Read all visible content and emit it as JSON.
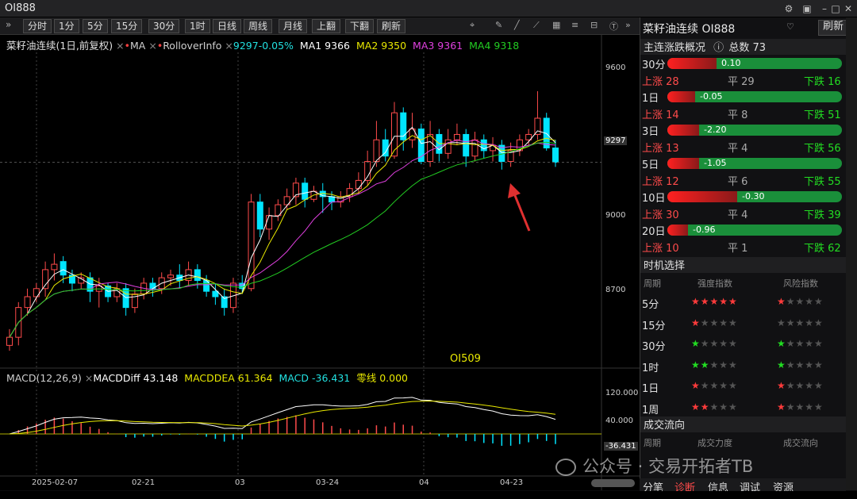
{
  "window": {
    "title": "OI888",
    "icons": [
      "gear-icon",
      "lock-icon",
      "minimize-icon",
      "maximize-icon",
      "close-icon"
    ]
  },
  "toolbar": {
    "expand": "»",
    "buttons": [
      "分时",
      "1分",
      "5分",
      "15分",
      "30分",
      "1时",
      "日线",
      "周线",
      "月线",
      "上翻",
      "下翻",
      "刷新"
    ]
  },
  "chart": {
    "legend": {
      "name": "菜籽油连续(1日,前复权)",
      "ma": "MA",
      "rollover": "RolloverInfo",
      "value": "9297-0.05%",
      "ma1": "MA1 9366",
      "ma2": "MA2 9350",
      "ma3": "MA3 9361",
      "ma4": "MA4 9318"
    },
    "prices": [
      "9600",
      "9297",
      "9000",
      "8700"
    ],
    "contract": "OI509",
    "macd": {
      "name": "MACD(12,26,9)",
      "diff": "MACDDiff 43.148",
      "dea": "MACDDEA 61.364",
      "macd": "MACD -36.431",
      "zero": "零线 0.000",
      "ticks": [
        "120.000",
        "40.000",
        "-36.431"
      ]
    },
    "dates": [
      "2025-02-07",
      "02-21",
      "03",
      "03-24",
      "04",
      "04-23"
    ],
    "colors": {
      "up": "#ff4b4b",
      "down": "#00e5ff",
      "ma1": "#ffffff",
      "ma2": "#e8e800",
      "ma3": "#e040e0",
      "ma4": "#22cc22"
    }
  },
  "chart_data": {
    "type": "candlestick",
    "title": "菜籽油连续(1日,前复权)",
    "ylim": [
      8580,
      9680
    ],
    "candles": [
      [
        8620,
        8650,
        8600,
        8680
      ],
      [
        8650,
        8760,
        8620,
        8780
      ],
      [
        8760,
        8800,
        8730,
        8830
      ],
      [
        8800,
        8830,
        8780,
        8850
      ],
      [
        8830,
        8900,
        8800,
        8930
      ],
      [
        8900,
        8920,
        8860,
        8960
      ],
      [
        8930,
        8880,
        8850,
        8950
      ],
      [
        8880,
        8850,
        8820,
        8900
      ],
      [
        8850,
        8870,
        8830,
        8890
      ],
      [
        8870,
        8820,
        8780,
        8890
      ],
      [
        8820,
        8840,
        8760,
        8870
      ],
      [
        8840,
        8800,
        8780,
        8850
      ],
      [
        8800,
        8830,
        8780,
        8850
      ],
      [
        8830,
        8760,
        8730,
        8850
      ],
      [
        8760,
        8810,
        8740,
        8830
      ],
      [
        8810,
        8850,
        8790,
        8870
      ],
      [
        8850,
        8830,
        8800,
        8870
      ],
      [
        8830,
        8870,
        8810,
        8890
      ],
      [
        8870,
        8880,
        8840,
        8900
      ],
      [
        8880,
        8860,
        8830,
        8920
      ],
      [
        8860,
        8900,
        8840,
        8930
      ],
      [
        8900,
        8860,
        8830,
        8920
      ],
      [
        8860,
        8820,
        8800,
        8880
      ],
      [
        8820,
        8800,
        8770,
        8850
      ],
      [
        8800,
        8760,
        8730,
        8830
      ],
      [
        8760,
        8850,
        8740,
        8870
      ],
      [
        8850,
        8830,
        8810,
        8880
      ],
      [
        8830,
        9150,
        8820,
        9180
      ],
      [
        9150,
        9050,
        9020,
        9180
      ],
      [
        9050,
        9100,
        9010,
        9130
      ],
      [
        9100,
        9140,
        9080,
        9160
      ],
      [
        9140,
        9170,
        9120,
        9200
      ],
      [
        9170,
        9220,
        9140,
        9240
      ],
      [
        9220,
        9160,
        9130,
        9240
      ],
      [
        9160,
        9190,
        9150,
        9210
      ],
      [
        9190,
        9170,
        9110,
        9220
      ],
      [
        9170,
        9150,
        9120,
        9190
      ],
      [
        9150,
        9170,
        9130,
        9190
      ],
      [
        9170,
        9200,
        9150,
        9220
      ],
      [
        9200,
        9230,
        9180,
        9260
      ],
      [
        9230,
        9300,
        9210,
        9340
      ],
      [
        9300,
        9380,
        9280,
        9450
      ],
      [
        9380,
        9320,
        9300,
        9420
      ],
      [
        9320,
        9480,
        9310,
        9520
      ],
      [
        9480,
        9380,
        9340,
        9500
      ],
      [
        9380,
        9420,
        9350,
        9480
      ],
      [
        9420,
        9300,
        9290,
        9440
      ],
      [
        9300,
        9400,
        9280,
        9450
      ],
      [
        9400,
        9330,
        9300,
        9420
      ],
      [
        9330,
        9380,
        9310,
        9420
      ],
      [
        9380,
        9400,
        9360,
        9440
      ],
      [
        9400,
        9320,
        9280,
        9420
      ],
      [
        9320,
        9380,
        9300,
        9410
      ],
      [
        9380,
        9340,
        9310,
        9400
      ],
      [
        9340,
        9360,
        9300,
        9390
      ],
      [
        9360,
        9300,
        9270,
        9380
      ],
      [
        9300,
        9340,
        9280,
        9370
      ],
      [
        9340,
        9380,
        9320,
        9400
      ],
      [
        9380,
        9400,
        9360,
        9420
      ],
      [
        9400,
        9460,
        9380,
        9560
      ],
      [
        9460,
        9350,
        9340,
        9480
      ],
      [
        9350,
        9297,
        9280,
        9380
      ]
    ],
    "series": [
      {
        "name": "MA1",
        "value": 9366
      },
      {
        "name": "MA2",
        "value": 9350
      },
      {
        "name": "MA3",
        "value": 9361
      },
      {
        "name": "MA4",
        "value": 9318
      }
    ],
    "macd": {
      "diff": 43.148,
      "dea": 61.364,
      "macd": -36.431,
      "zero": 0
    }
  },
  "panel": {
    "title": "菜籽油连续 OI888",
    "refresh": "刷新",
    "overview_title": "主连涨跌概况",
    "total": "总数 73",
    "rows": [
      {
        "period": "30分",
        "value": "0.10",
        "red": 0.28,
        "up": "上涨 28",
        "flat": "平 29",
        "down": "下跌 16"
      },
      {
        "period": "1日",
        "value": "-0.05",
        "red": 0.16,
        "up": "上涨 14",
        "flat": "平 8",
        "down": "下跌 51"
      },
      {
        "period": "3日",
        "value": "-2.20",
        "red": 0.18,
        "up": "上涨 13",
        "flat": "平 4",
        "down": "下跌 56"
      },
      {
        "period": "5日",
        "value": "-1.05",
        "red": 0.18,
        "up": "上涨 12",
        "flat": "平 6",
        "down": "下跌 55"
      },
      {
        "period": "10日",
        "value": "-0.30",
        "red": 0.4,
        "up": "上涨 30",
        "flat": "平 4",
        "down": "下跌 39"
      },
      {
        "period": "20日",
        "value": "-0.96",
        "red": 0.12,
        "up": "上涨 10",
        "flat": "平 1",
        "down": "下跌 62"
      }
    ],
    "timing_title": "时机选择",
    "timing_headers": [
      "周期",
      "强度指数",
      "风险指数"
    ],
    "timing": [
      {
        "period": "5分",
        "strength": 5,
        "s_color": "#ff3b3b",
        "risk": 1,
        "r_color": "#ff3b3b"
      },
      {
        "period": "15分",
        "strength": 1,
        "s_color": "#ff3b3b",
        "risk": 0,
        "r_color": "#ff3b3b"
      },
      {
        "period": "30分",
        "strength": 1,
        "s_color": "#22dd22",
        "risk": 1,
        "r_color": "#22dd22"
      },
      {
        "period": "1时",
        "strength": 2,
        "s_color": "#22dd22",
        "risk": 1,
        "r_color": "#22dd22"
      },
      {
        "period": "1日",
        "strength": 1,
        "s_color": "#ff3b3b",
        "risk": 1,
        "r_color": "#ff3b3b"
      },
      {
        "period": "1周",
        "strength": 2,
        "s_color": "#ff3b3b",
        "risk": 1,
        "r_color": "#ff3b3b"
      }
    ],
    "flow_title": "成交流向",
    "flow_headers": [
      "周期",
      "成交力度",
      "成交流向"
    ],
    "tabs": [
      "分笔",
      "诊断",
      "信息",
      "调试",
      "资源"
    ]
  },
  "watermark": "公众号 · 交易开拓者TB"
}
